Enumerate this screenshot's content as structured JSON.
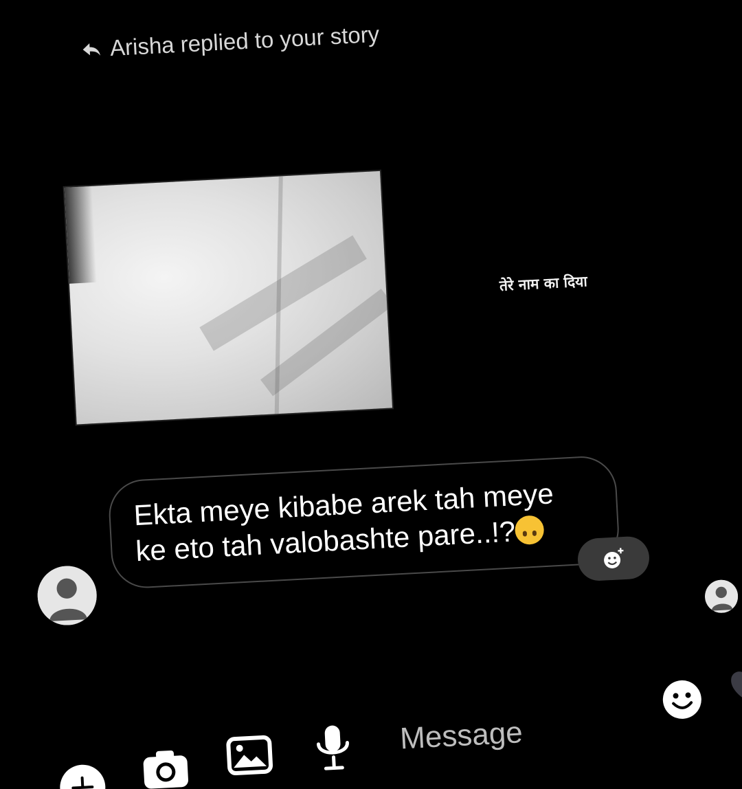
{
  "reply_context": {
    "text": "Arisha replied to your story",
    "icon": "reply-arrow-icon"
  },
  "story": {
    "caption": "तेरे नाम का दिया"
  },
  "message": {
    "line1": "Ekta meye kibabe arek tah meye",
    "line2": "ke eto tah valobashte pare..!?",
    "emoji": "upside-down-face-emoji"
  },
  "composer": {
    "placeholder": "Message",
    "icons": [
      "add-icon",
      "camera-icon",
      "gallery-icon",
      "microphone-icon",
      "sticker-icon",
      "heart-icon"
    ]
  },
  "colors": {
    "background": "#000000",
    "bubble_border": "#4a4a4a",
    "react_bg": "#3a3a3a",
    "emoji_yellow": "#f7c234"
  }
}
